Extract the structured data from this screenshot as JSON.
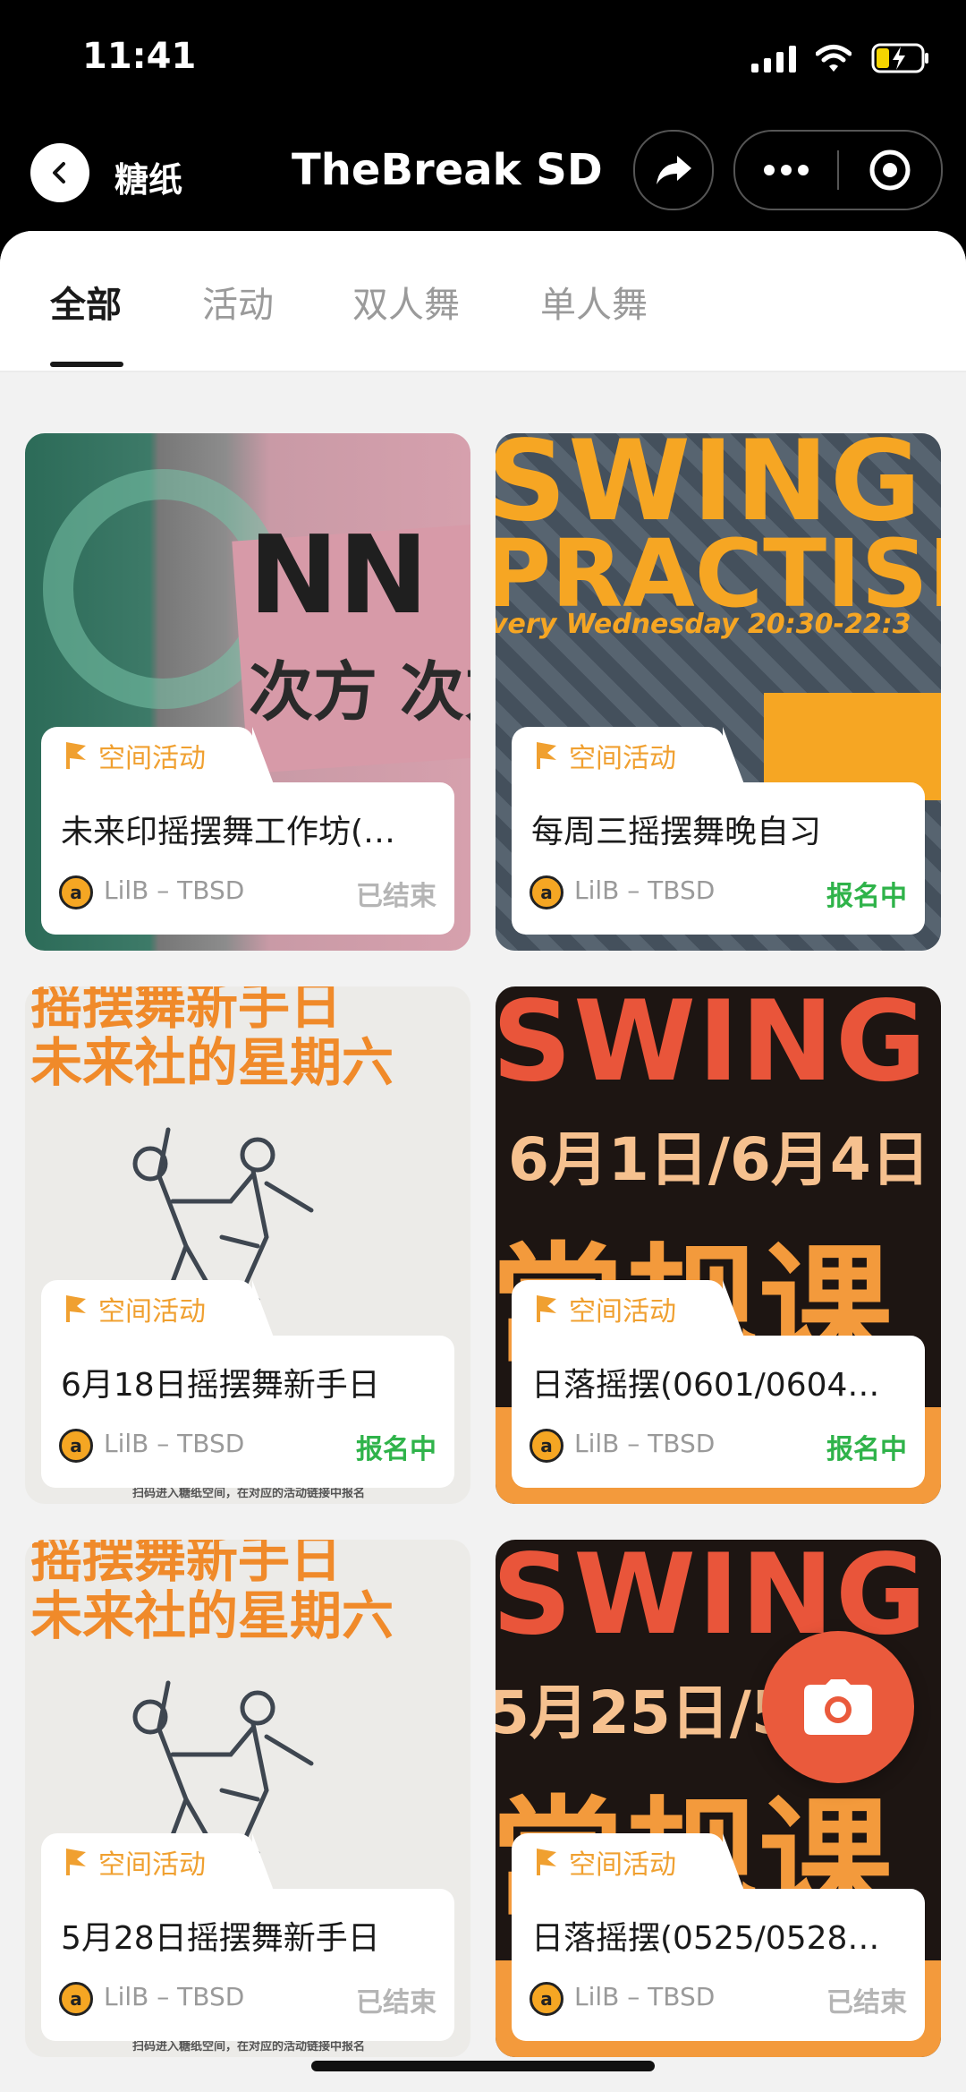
{
  "status_bar": {
    "time": "11:41"
  },
  "nav": {
    "back_label": "糖纸",
    "title": "TheBreak SD"
  },
  "tabs": [
    {
      "label": "全部",
      "active": true
    },
    {
      "label": "活动",
      "active": false
    },
    {
      "label": "双人舞",
      "active": false
    },
    {
      "label": "单人舞",
      "active": false
    }
  ],
  "colors": {
    "tag": "#f0a030",
    "open": "#2fb34a",
    "ended": "#b5b5b5",
    "fab": "#ea5a3c"
  },
  "cards": [
    {
      "tag": "空间活动",
      "title": "未来印摇摆舞工作坊(…",
      "organizer": "LilB – TBSD",
      "status": "已结束",
      "status_type": "ended",
      "poster": {
        "lines": [
          "次方 次方"
        ]
      }
    },
    {
      "tag": "空间活动",
      "title": "每周三摇摆舞晚自习",
      "organizer": "LilB – TBSD",
      "status": "报名中",
      "status_type": "open",
      "poster": {
        "lines": [
          "SWING",
          "PRACTISE",
          "very Wednesday 20:30-22:3"
        ]
      }
    },
    {
      "tag": "空间活动",
      "title": "6月18日摇摆舞新手日",
      "organizer": "LilB – TBSD",
      "status": "报名中",
      "status_type": "open",
      "poster": {
        "lines": [
          "摇摆舞新手日",
          "未来社的星期六",
          "扫码进入糖纸空间，在对应的活动链接中报名"
        ]
      }
    },
    {
      "tag": "空间活动",
      "title": "日落摇摆(0601/0604…",
      "organizer": "LilB – TBSD",
      "status": "报名中",
      "status_type": "open",
      "poster": {
        "lines": [
          "SWING",
          "6月1日/6月4日",
          "常规课"
        ]
      }
    },
    {
      "tag": "空间活动",
      "title": "5月28日摇摆舞新手日",
      "organizer": "LilB – TBSD",
      "status": "已结束",
      "status_type": "ended",
      "poster": {
        "lines": [
          "摇摆舞新手日",
          "未来社的星期六",
          "扫码进入糖纸空间，在对应的活动链接中报名"
        ]
      }
    },
    {
      "tag": "空间活动",
      "title": "日落摇摆(0525/0528…",
      "organizer": "LilB – TBSD",
      "status": "已结束",
      "status_type": "ended",
      "poster": {
        "lines": [
          "SWING",
          "5月25日/5",
          "常规课"
        ]
      }
    }
  ]
}
